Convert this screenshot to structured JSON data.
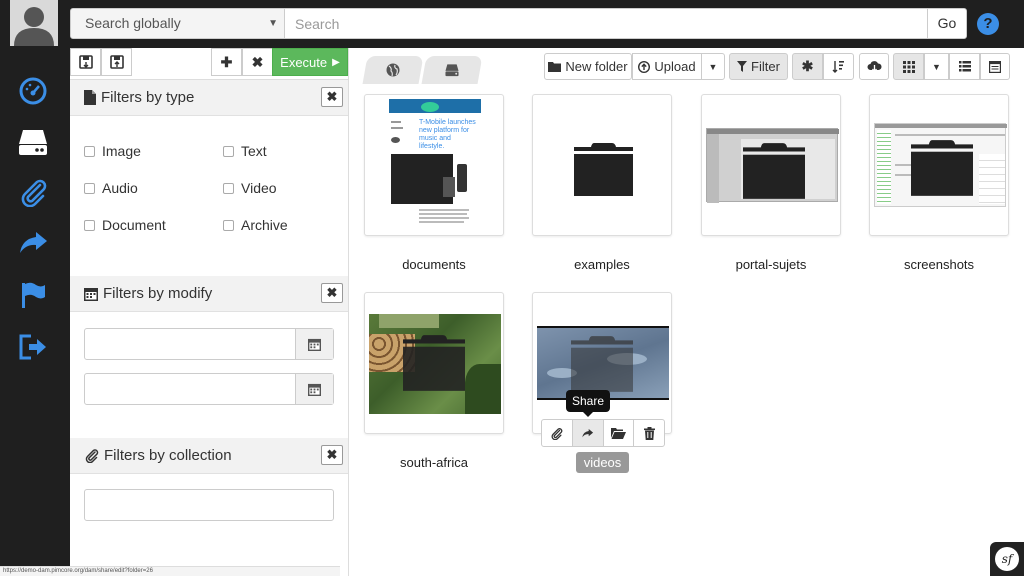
{
  "colors": {
    "accent": "#3b8ee6",
    "nav_bg": "#1f1f1f",
    "execute_bg": "#5cb85c",
    "panel_bg": "#f2f2f2"
  },
  "header": {
    "scope_select": "Search globally",
    "search_placeholder": "Search",
    "go_label": "Go",
    "help_label": "?"
  },
  "leftnav": {
    "items": [
      "dashboard-icon",
      "drive-icon",
      "paperclip-icon",
      "share-icon",
      "flag-icon",
      "logout-icon"
    ]
  },
  "filters": {
    "toolbar": {
      "execute_label": "Execute"
    },
    "by_type": {
      "title": "Filters by type",
      "options": [
        "Image",
        "Text",
        "Audio",
        "Video",
        "Document",
        "Archive"
      ]
    },
    "by_modify": {
      "title": "Filters by modify"
    },
    "by_collection": {
      "title": "Filters by collection"
    },
    "close_label": "✖"
  },
  "toolbar": {
    "new_folder_label": "New folder",
    "upload_label": "Upload",
    "filter_label": "Filter"
  },
  "folders": [
    {
      "name": "documents"
    },
    {
      "name": "examples"
    },
    {
      "name": "portal-sujets"
    },
    {
      "name": "screenshots"
    },
    {
      "name": "south-africa"
    },
    {
      "name": "videos"
    }
  ],
  "thumbnail_text": {
    "documents_headline": "T-Mobile launches new platform for music and lifestyle."
  },
  "tooltip": {
    "label": "Share"
  },
  "statusbar": {
    "url": "https://demo-dam.pimcore.org/dam/share/edit?folder=26"
  },
  "badge": {
    "label": "sf"
  }
}
